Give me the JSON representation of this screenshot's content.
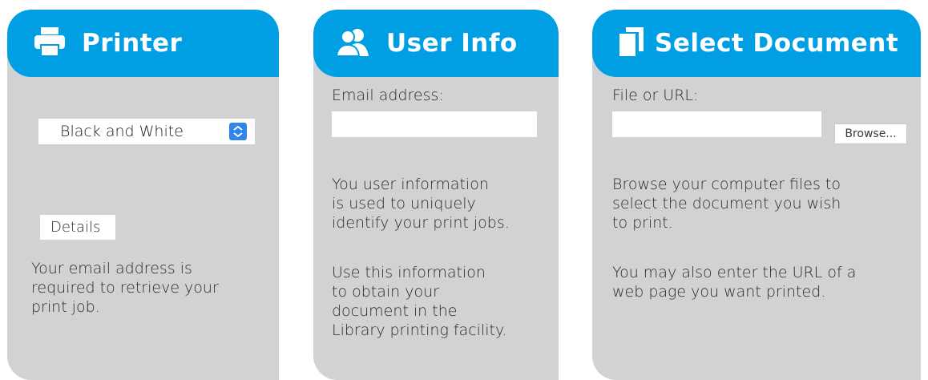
{
  "colors": {
    "header": "#009fe3",
    "panel": "#d1d2d4",
    "select_arrow": "#2d86e8"
  },
  "printer": {
    "title": "Printer",
    "icon": "printer-icon",
    "mode_value": "Black and White",
    "details_label": "Details",
    "note_lines": [
      "Your email address is",
      "required to retrieve your",
      "print job."
    ]
  },
  "user_info": {
    "title": "User Info",
    "icon": "users-icon",
    "email_label": "Email address:",
    "email_value": "",
    "para1_lines": [
      "You user information",
      "is used to uniquely",
      "identify your print jobs."
    ],
    "para2_lines": [
      "Use this information",
      "to obtain your",
      "document in the",
      "Library printing facility."
    ]
  },
  "select_document": {
    "title": "Select Document",
    "icon": "document-icon",
    "file_label": "File or URL:",
    "file_value": "",
    "browse_label": "Browse...",
    "para1_lines": [
      "Browse your computer files to",
      "select the document you wish",
      "to print."
    ],
    "para2_lines": [
      "You may also enter the URL of a",
      "web page you want printed."
    ]
  }
}
